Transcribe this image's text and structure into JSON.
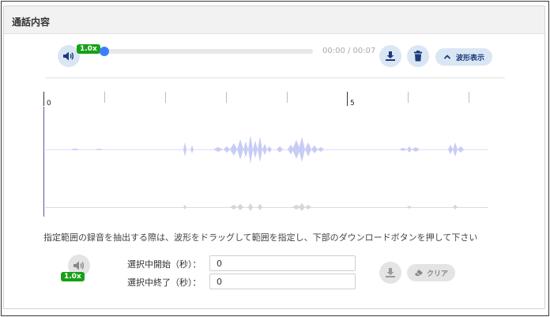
{
  "panel": {
    "title": "通話内容"
  },
  "player": {
    "speed_badge": "1.0x",
    "time_display": "00:00 / 00:07",
    "progress": 0,
    "waveform_button_label": "波形表示",
    "icons": {
      "volume": "volume-icon",
      "download": "download-icon",
      "delete": "trash-icon",
      "chevron": "chevron-up-icon"
    }
  },
  "timeline": {
    "tick_labels": [
      "0",
      "5"
    ]
  },
  "selection": {
    "hint": "指定範囲の録音を抽出する際は、波形をドラッグして範囲を指定し、下部のダウンロードボタンを押して下さい",
    "speed_badge": "1.0x",
    "start_label": "選択中開始（秒）：",
    "start_value": "0",
    "end_label": "選択中終了（秒）：",
    "end_value": "0",
    "clear_label": "クリア",
    "icons": {
      "volume": "volume-icon",
      "download": "download-icon",
      "eraser": "eraser-icon"
    }
  },
  "colors": {
    "accent": "#3d7eff",
    "badge": "#18a018",
    "button_bg": "#dbe6f5",
    "waveform": "#c8ccf5"
  }
}
